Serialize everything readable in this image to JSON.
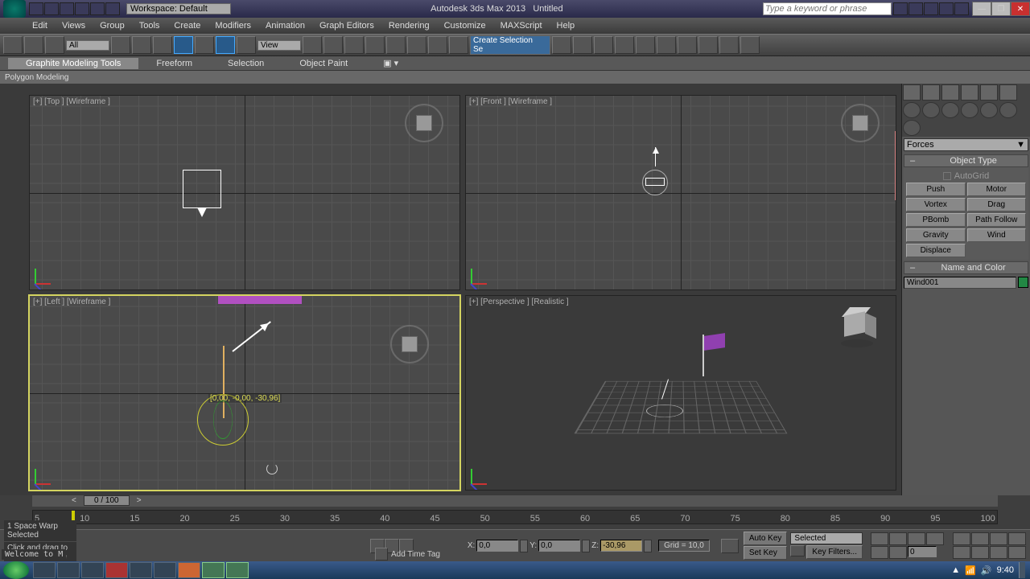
{
  "title": {
    "app": "Autodesk 3ds Max 2013",
    "doc": "Untitled",
    "workspace_label": "Workspace: Default",
    "search_placeholder": "Type a keyword or phrase"
  },
  "menus": [
    "Edit",
    "Views",
    "Group",
    "Tools",
    "Create",
    "Modifiers",
    "Animation",
    "Graph Editors",
    "Rendering",
    "Customize",
    "MAXScript",
    "Help"
  ],
  "toolbar": {
    "filter": "All",
    "refcoord": "View",
    "named_sel": "Create Selection Se"
  },
  "ribbon": {
    "tabs": [
      "Graphite Modeling Tools",
      "Freeform",
      "Selection",
      "Object Paint"
    ],
    "sub": "Polygon Modeling"
  },
  "viewports": {
    "top": "[+] [Top ] [Wireframe ]",
    "front": "[+] [Front ] [Wireframe ]",
    "left": "[+] [Left ] [Wireframe ]",
    "persp": "[+] [Perspective ] [Realistic ]",
    "rotate_readout": "[0,00, -0,00, -30,96]"
  },
  "cmdpanel": {
    "category": "Forces",
    "rollout1": "Object Type",
    "autogrid": "AutoGrid",
    "buttons": [
      "Push",
      "Motor",
      "Vortex",
      "Drag",
      "PBomb",
      "Path Follow",
      "Gravity",
      "Wind",
      "Displace"
    ],
    "rollout2": "Name and Color",
    "objname": "Wind001"
  },
  "timeline": {
    "slider": "0 / 100",
    "ticks": [
      "5",
      "10",
      "15",
      "20",
      "25",
      "30",
      "35",
      "40",
      "45",
      "50",
      "55",
      "60",
      "65",
      "70",
      "75",
      "80",
      "85",
      "90",
      "95",
      "100"
    ]
  },
  "status": {
    "selection": "1 Space Warp Selected",
    "hint": "Click and drag to select and rotate objects",
    "prompt": "Welcome to M",
    "x": "0,0",
    "y": "0,0",
    "z": "-30,96",
    "grid": "Grid = 10,0",
    "autokey": "Auto Key",
    "setkey": "Set Key",
    "keymode": "Selected",
    "keyfilters": "Key Filters...",
    "frame": "0",
    "addtimetag": "Add Time Tag"
  },
  "tray": {
    "time": "9:40"
  }
}
